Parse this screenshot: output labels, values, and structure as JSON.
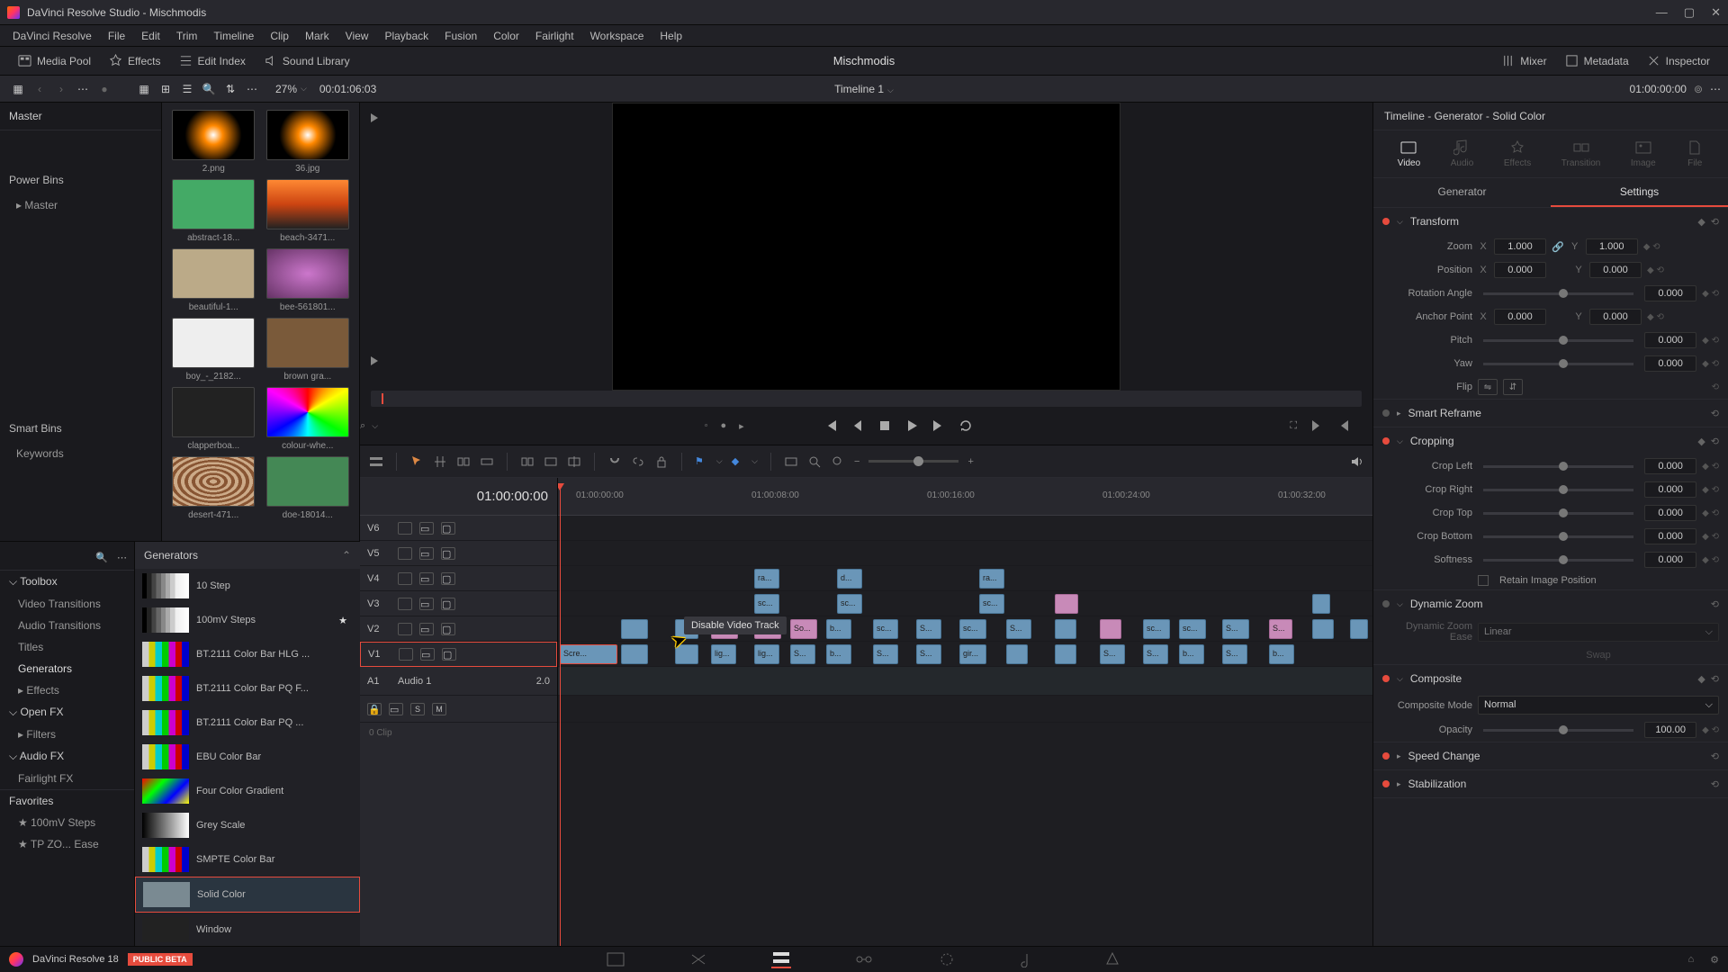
{
  "app": {
    "title": "DaVinci Resolve Studio - Mischmodis",
    "version": "DaVinci Resolve 18",
    "beta": "PUBLIC BETA",
    "project": "Mischmodis"
  },
  "menu": [
    "DaVinci Resolve",
    "File",
    "Edit",
    "Trim",
    "Timeline",
    "Clip",
    "Mark",
    "View",
    "Playback",
    "Fusion",
    "Color",
    "Fairlight",
    "Workspace",
    "Help"
  ],
  "toolbar": {
    "mediapool": "Media Pool",
    "effects": "Effects",
    "editindex": "Edit Index",
    "soundlib": "Sound Library",
    "mixer": "Mixer",
    "metadata": "Metadata",
    "inspector": "Inspector"
  },
  "secondbar": {
    "zoom": "27%",
    "tc": "00:01:06:03",
    "timeline_name": "Timeline 1",
    "record_tc": "01:00:00:00"
  },
  "bins": {
    "master": "Master",
    "power": "Power Bins",
    "power_master": "Master",
    "smart": "Smart Bins",
    "keywords": "Keywords",
    "favorites": "Favorites",
    "fav1": "100mV Steps",
    "fav2": "TP ZO... Ease"
  },
  "media": [
    {
      "label": "2.png",
      "cls": "thumb-lens"
    },
    {
      "label": "36.jpg",
      "cls": "thumb-lens"
    },
    {
      "label": "abstract-18...",
      "cls": "thumb-green"
    },
    {
      "label": "beach-3471...",
      "cls": "thumb-sunset"
    },
    {
      "label": "beautiful-1...",
      "cls": "thumb-girl"
    },
    {
      "label": "bee-561801...",
      "cls": "thumb-flower"
    },
    {
      "label": "boy_-_2182...",
      "cls": "thumb-dance"
    },
    {
      "label": "brown gra...",
      "cls": "thumb-brown"
    },
    {
      "label": "clapperboa...",
      "cls": "thumb-clap"
    },
    {
      "label": "colour-whe...",
      "cls": "thumb-wheel"
    },
    {
      "label": "desert-471...",
      "cls": "thumb-leopard"
    },
    {
      "label": "doe-18014...",
      "cls": "thumb-deer"
    }
  ],
  "effects": {
    "header": "Generators",
    "tree": {
      "toolbox": "Toolbox",
      "vt": "Video Transitions",
      "at": "Audio Transitions",
      "titles": "Titles",
      "gen": "Generators",
      "eff": "Effects",
      "openfx": "Open FX",
      "filters": "Filters",
      "audiofx": "Audio FX",
      "fairfx": "Fairlight FX"
    },
    "items": [
      {
        "label": "10 Step",
        "cls": "sw-step"
      },
      {
        "label": "100mV Steps",
        "cls": "sw-step",
        "star": true
      },
      {
        "label": "BT.2111 Color Bar HLG ...",
        "cls": "sw-bars"
      },
      {
        "label": "BT.2111 Color Bar PQ F...",
        "cls": "sw-bars"
      },
      {
        "label": "BT.2111 Color Bar PQ ...",
        "cls": "sw-bars"
      },
      {
        "label": "EBU Color Bar",
        "cls": "sw-bars"
      },
      {
        "label": "Four Color Gradient",
        "cls": "sw-4grad"
      },
      {
        "label": "Grey Scale",
        "cls": "sw-grey"
      },
      {
        "label": "SMPTE Color Bar",
        "cls": "sw-bars"
      },
      {
        "label": "Solid Color",
        "cls": "sw-solid",
        "sel": true
      },
      {
        "label": "Window",
        "cls": "sw-window"
      }
    ]
  },
  "timeline": {
    "head_tc": "01:00:00:00",
    "ruler": [
      "01:00:00:00",
      "01:00:08:00",
      "01:00:16:00",
      "01:00:24:00",
      "01:00:32:00"
    ],
    "tracks": [
      "V6",
      "V5",
      "V4",
      "V3",
      "V2",
      "V1"
    ],
    "audio": {
      "name": "A1",
      "sub": "Audio 1",
      "ch": "2.0",
      "clips": "0 Clip"
    },
    "tooltip": "Disable Video Track"
  },
  "inspector": {
    "title": "Timeline - Generator - Solid Color",
    "tabs": {
      "video": "Video",
      "audio": "Audio",
      "effects": "Effects",
      "transition": "Transition",
      "image": "Image",
      "file": "File"
    },
    "subtabs": {
      "generator": "Generator",
      "settings": "Settings"
    },
    "transform": {
      "title": "Transform",
      "zoom": "Zoom",
      "zoom_x": "1.000",
      "zoom_y": "1.000",
      "position": "Position",
      "pos_x": "0.000",
      "pos_y": "0.000",
      "rotation": "Rotation Angle",
      "rotation_v": "0.000",
      "anchor": "Anchor Point",
      "anchor_x": "0.000",
      "anchor_y": "0.000",
      "pitch": "Pitch",
      "pitch_v": "0.000",
      "yaw": "Yaw",
      "yaw_v": "0.000",
      "flip": "Flip"
    },
    "smartreframe": "Smart Reframe",
    "cropping": {
      "title": "Cropping",
      "left": "Crop Left",
      "left_v": "0.000",
      "right": "Crop Right",
      "right_v": "0.000",
      "top": "Crop Top",
      "top_v": "0.000",
      "bottom": "Crop Bottom",
      "bottom_v": "0.000",
      "soft": "Softness",
      "soft_v": "0.000",
      "retain": "Retain Image Position"
    },
    "dynzoom": {
      "title": "Dynamic Zoom",
      "ease": "Dynamic Zoom Ease",
      "ease_v": "Linear",
      "swap": "Swap"
    },
    "composite": {
      "title": "Composite",
      "mode": "Composite Mode",
      "mode_v": "Normal",
      "opacity": "Opacity",
      "opacity_v": "100.00"
    },
    "speed": "Speed Change",
    "stab": "Stabilization"
  }
}
